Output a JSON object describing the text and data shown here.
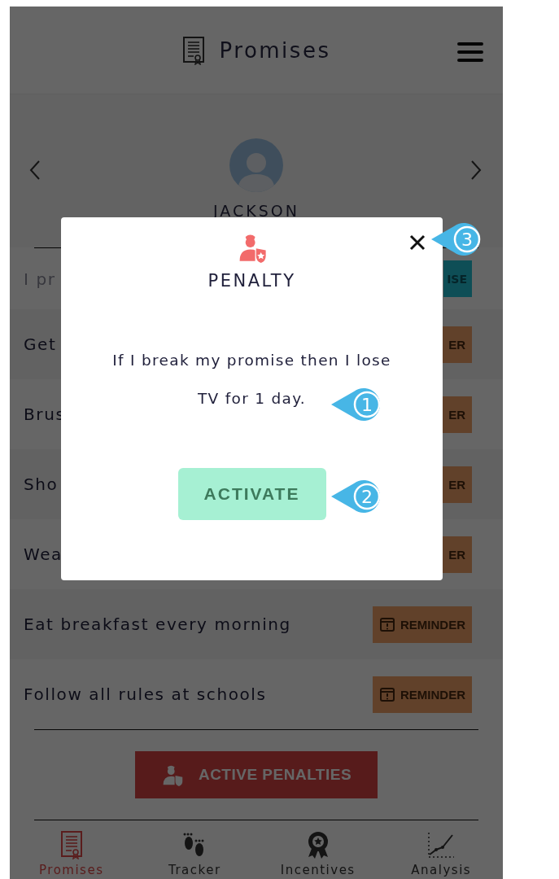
{
  "header": {
    "title": "Promises"
  },
  "profile": {
    "name": "JACKSON"
  },
  "promise_input": {
    "placeholder": "I pr",
    "button": "ISE"
  },
  "promises": [
    {
      "text": "Get",
      "button": "ER",
      "kind": "cut"
    },
    {
      "text": "Brus",
      "button": "ER",
      "kind": "cut"
    },
    {
      "text": "Sho",
      "button": "ER",
      "kind": "cut"
    },
    {
      "text": "Wea",
      "button": "ER",
      "kind": "cut"
    },
    {
      "text": "Eat breakfast every morning",
      "button": "REMINDER",
      "kind": "full"
    },
    {
      "text": "Follow all rules at schools",
      "button": "REMINDER",
      "kind": "full"
    }
  ],
  "active_penalties_button": "ACTIVE PENALTIES",
  "bottom_nav": [
    {
      "label": "Promises",
      "selected": true
    },
    {
      "label": "Tracker",
      "selected": false
    },
    {
      "label": "Incentives",
      "selected": false
    },
    {
      "label": "Analysis",
      "selected": false
    }
  ],
  "modal": {
    "title": "PENALTY",
    "message_lines": [
      "If I break my promise then I lose",
      "TV for 1 day."
    ],
    "button": "ACTIVATE"
  },
  "callouts": [
    "1",
    "2",
    "3"
  ]
}
